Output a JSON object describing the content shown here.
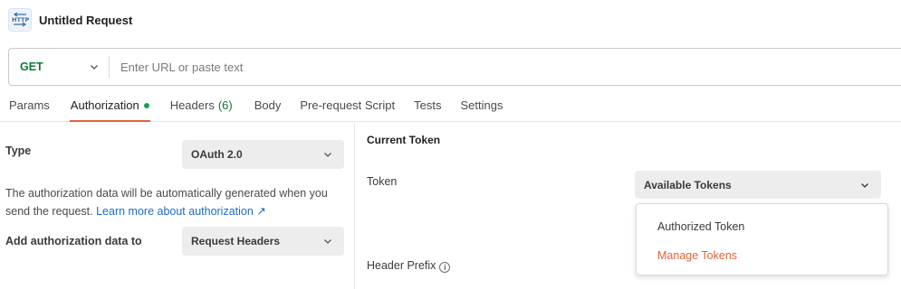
{
  "request": {
    "title": "Untitled Request",
    "icon": "http-request-icon"
  },
  "url_bar": {
    "method": "GET",
    "placeholder": "Enter URL or paste text",
    "value": ""
  },
  "tabs": [
    {
      "label": "Params"
    },
    {
      "label": "Authorization",
      "active": true,
      "indicator": "green-dot"
    },
    {
      "label": "Headers",
      "count": "(6)"
    },
    {
      "label": "Body"
    },
    {
      "label": "Pre-request Script"
    },
    {
      "label": "Tests"
    },
    {
      "label": "Settings"
    }
  ],
  "auth": {
    "type_label": "Type",
    "type_value": "OAuth 2.0",
    "description": "The authorization data will be automatically generated when you send the request.",
    "learn_more": "Learn more about authorization ↗",
    "add_to_label": "Add authorization data to",
    "add_to_value": "Request Headers"
  },
  "current_token": {
    "section_title": "Current Token",
    "token_label": "Token",
    "token_select": "Available Tokens",
    "header_prefix_label": "Header Prefix",
    "menu_items": [
      {
        "label": "Authorized Token",
        "style": "normal"
      },
      {
        "label": "Manage Tokens",
        "style": "accent"
      }
    ]
  },
  "colors": {
    "accent": "#e0643a",
    "method_green": "#0d7a3a",
    "link": "#1d6cc2",
    "active_dot": "#12a454"
  }
}
